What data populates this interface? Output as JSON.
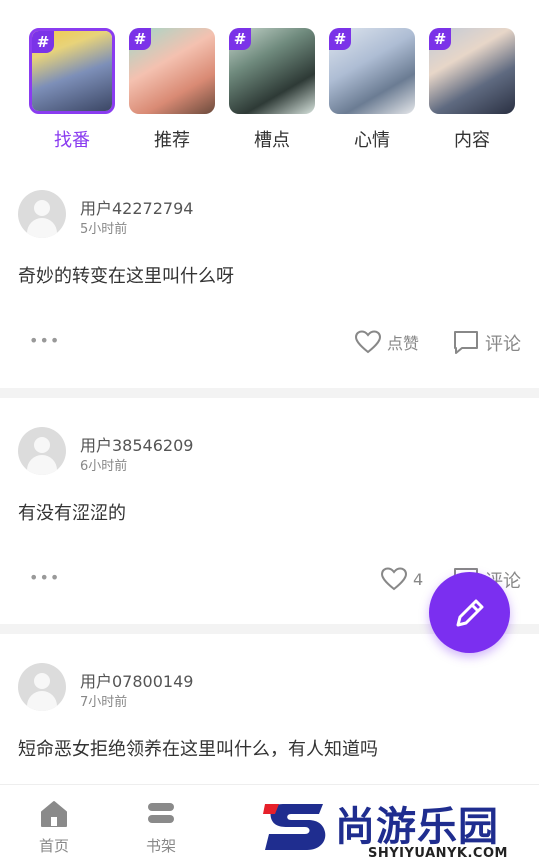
{
  "topics": [
    {
      "label": "找番",
      "active": true
    },
    {
      "label": "推荐",
      "active": false
    },
    {
      "label": "槽点",
      "active": false
    },
    {
      "label": "心情",
      "active": false
    },
    {
      "label": "内容",
      "active": false
    }
  ],
  "topic_badge": "#",
  "posts": [
    {
      "user": "用户42272794",
      "time": "5小时前",
      "text": "奇妙的转变在这里叫什么呀",
      "like_label": "点赞",
      "comment_label": "评论"
    },
    {
      "user": "用户38546209",
      "time": "6小时前",
      "text": "有没有涩涩的",
      "like_label": "4",
      "comment_label": "评论"
    },
    {
      "user": "用户07800149",
      "time": "7小时前",
      "text": "短命恶女拒绝领养在这里叫什么，有人知道吗"
    }
  ],
  "more_label": "•••",
  "nav": [
    {
      "label": "首页"
    },
    {
      "label": "书架"
    }
  ],
  "watermark": {
    "title": "尚游乐园",
    "subtitle": "SHYIYUANYK.COM"
  },
  "colors": {
    "accent": "#8a3cf0",
    "fab": "#7b2ff0",
    "watermark_blue": "#1f2d8f"
  }
}
